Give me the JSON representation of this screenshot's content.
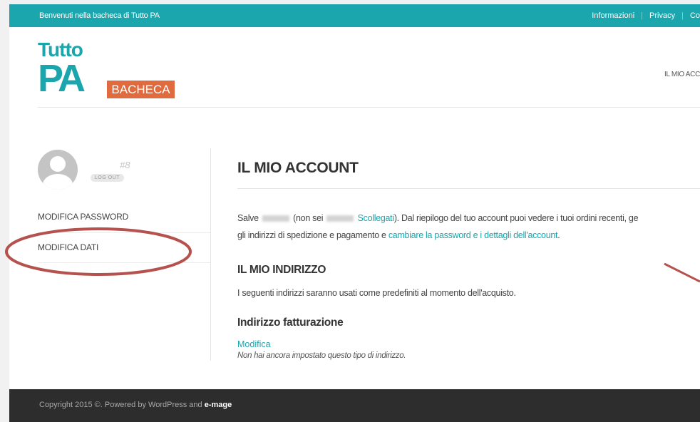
{
  "topbar": {
    "welcome": "Benvenuti nella bacheca di Tutto PA",
    "links": [
      "Informazioni",
      "Privacy",
      "Co"
    ]
  },
  "logo": {
    "line1": "Tutto",
    "line2": "PA",
    "badge": "BACHECA"
  },
  "nav": {
    "my_account": "IL MIO ACC"
  },
  "sidebar": {
    "user_number": "#8",
    "logout": "LOG OUT",
    "menu": [
      "MODIFICA PASSWORD",
      "MODIFICA DATI"
    ]
  },
  "content": {
    "title": "IL MIO ACCOUNT",
    "intro": {
      "salve": "Salve",
      "non_sei": "(non sei",
      "logout_link": "Scollegati",
      "after_link": "). Dal riepilogo del tuo account puoi vedere i tuoi ordini recenti, ge",
      "line2_start": "gli indirizzi di spedizione e pagamento e ",
      "line2_link": "cambiare la password e i dettagli dell'account",
      "line2_end": "."
    },
    "address_title": "IL MIO INDIRIZZO",
    "address_desc": "I seguenti indirizzi saranno usati come predefiniti al momento dell'acquisto.",
    "billing_title": "Indirizzo fatturazione",
    "edit_link": "Modifica",
    "no_address": "Non hai ancora impostato questo tipo di indirizzo."
  },
  "footer": {
    "copyright": "Copyright 2015 ©. Powered by WordPress and ",
    "brand": "e-mage"
  },
  "colors": {
    "accent": "#1ba5ad",
    "badge": "#e06b3f",
    "annotation": "#b5524e",
    "footer": "#2d2d2d"
  }
}
